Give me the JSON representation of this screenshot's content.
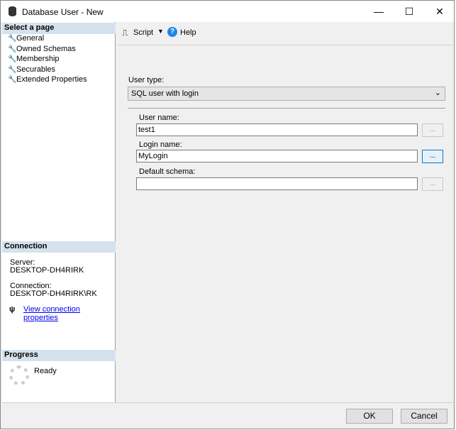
{
  "window": {
    "title": "Database User - New",
    "minimize": "—",
    "maximize": "☐",
    "close": "✕"
  },
  "left": {
    "select_header": "Select a page",
    "pages": [
      "General",
      "Owned Schemas",
      "Membership",
      "Securables",
      "Extended Properties"
    ],
    "connection_header": "Connection",
    "server_label": "Server:",
    "server_value": "DESKTOP-DH4RIRK",
    "connection_label": "Connection:",
    "connection_value": "DESKTOP-DH4RIRK\\RK",
    "view_link": "View connection properties",
    "progress_header": "Progress",
    "progress_status": "Ready"
  },
  "toolbar": {
    "script": "Script",
    "help": "Help"
  },
  "form": {
    "user_type_label": "User type:",
    "user_type_value": "SQL user with login",
    "user_name_label": "User name:",
    "user_name_value": "test1",
    "login_name_label": "Login name:",
    "login_name_value": "MyLogin",
    "default_schema_label": "Default schema:",
    "default_schema_value": "",
    "browse": "..."
  },
  "buttons": {
    "ok": "OK",
    "cancel": "Cancel"
  }
}
